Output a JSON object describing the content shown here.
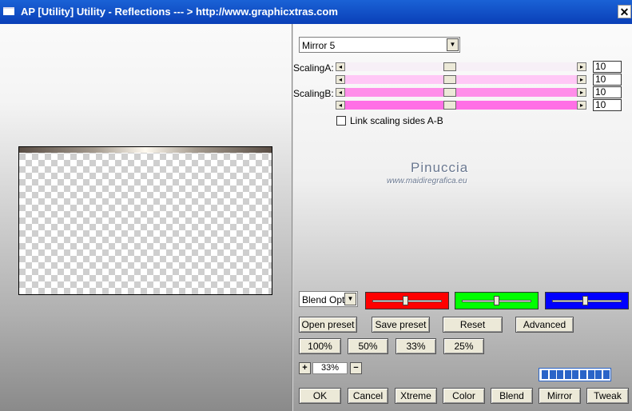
{
  "window": {
    "title": "AP [Utility]  Utility - Reflections     --- > http://www.graphicxtras.com",
    "close_label": "✕"
  },
  "preset": {
    "selected": "Mirror 5"
  },
  "scaling": {
    "label_a": "ScalingA:",
    "label_b": "ScalingB:",
    "sliders": [
      {
        "value": "10",
        "color": "#f7f0f7",
        "level": 0.45
      },
      {
        "value": "10",
        "color": "#ffc8f6",
        "level": 0.45
      },
      {
        "value": "10",
        "color": "#ff8ee9",
        "level": 0.45
      },
      {
        "value": "10",
        "color": "#ff6fe6",
        "level": 0.45
      }
    ]
  },
  "link_scaling": {
    "label": "Link scaling sides A-B",
    "checked": false
  },
  "watermark": {
    "name": "Pinuccia",
    "url": "www.maidiregrafica.eu"
  },
  "blend": {
    "selected": "Blend Optio",
    "channels": [
      {
        "color": "#ff0000",
        "level": 0.48
      },
      {
        "color": "#00ff00",
        "level": 0.5
      },
      {
        "color": "#0000ff",
        "level": 0.48
      }
    ]
  },
  "buttons": {
    "open_preset": "Open preset",
    "save_preset": "Save preset",
    "reset": "Reset",
    "advanced": "Advanced",
    "zoom100": "100%",
    "zoom50": "50%",
    "zoom33": "33%",
    "zoom25": "25%",
    "ok": "OK",
    "cancel": "Cancel",
    "xtreme": "Xtreme",
    "color": "Color",
    "blend": "Blend",
    "mirror": "Mirror",
    "tweak": "Tweak"
  },
  "zoom": {
    "plus": "+",
    "minus": "−",
    "value": "33%"
  },
  "progress": {
    "segments": 9,
    "filled": 9
  }
}
